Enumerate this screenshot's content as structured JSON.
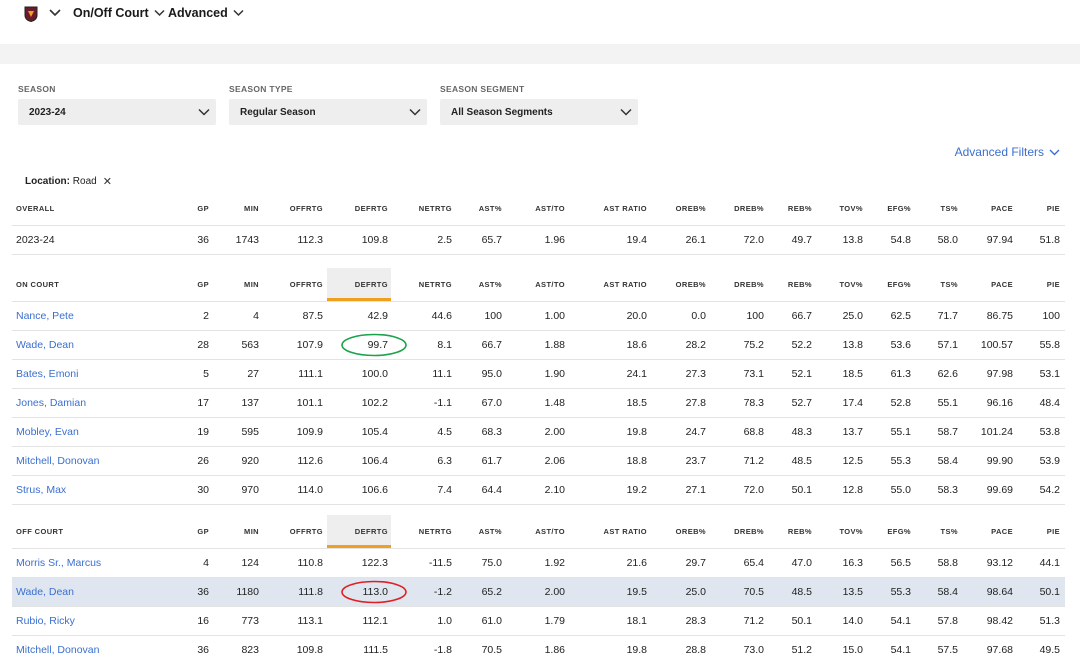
{
  "nav": {
    "items": [
      {
        "label": "On/Off Court"
      },
      {
        "label": "Advanced"
      }
    ]
  },
  "filters": [
    {
      "label": "SEASON",
      "value": "2023-24"
    },
    {
      "label": "SEASON TYPE",
      "value": "Regular Season"
    },
    {
      "label": "SEASON SEGMENT",
      "value": "All Season Segments"
    }
  ],
  "advanced_filters_label": "Advanced Filters",
  "location_tag": {
    "key": "Location:",
    "value": "Road"
  },
  "columns": [
    "GP",
    "MIN",
    "OFFRTG",
    "DEFRTG",
    "NETRTG",
    "AST%",
    "AST/TO",
    "AST RATIO",
    "OREB%",
    "DREB%",
    "REB%",
    "TOV%",
    "EFG%",
    "TS%",
    "PACE",
    "PIE"
  ],
  "overall": {
    "title": "OVERALL",
    "rows": [
      {
        "name": "2023-24",
        "values": [
          "36",
          "1743",
          "112.3",
          "109.8",
          "2.5",
          "65.7",
          "1.96",
          "19.4",
          "26.1",
          "72.0",
          "49.7",
          "13.8",
          "54.8",
          "58.0",
          "97.94",
          "51.8"
        ]
      }
    ]
  },
  "on_court": {
    "title": "ON COURT",
    "rows": [
      {
        "name": "Nance, Pete",
        "values": [
          "2",
          "4",
          "87.5",
          "42.9",
          "44.6",
          "100",
          "1.00",
          "20.0",
          "0.0",
          "100",
          "66.7",
          "25.0",
          "62.5",
          "71.7",
          "86.75",
          "100"
        ]
      },
      {
        "name": "Wade, Dean",
        "values": [
          "28",
          "563",
          "107.9",
          "99.7",
          "8.1",
          "66.7",
          "1.88",
          "18.6",
          "28.2",
          "75.2",
          "52.2",
          "13.8",
          "53.6",
          "57.1",
          "100.57",
          "55.8"
        ]
      },
      {
        "name": "Bates, Emoni",
        "values": [
          "5",
          "27",
          "111.1",
          "100.0",
          "11.1",
          "95.0",
          "1.90",
          "24.1",
          "27.3",
          "73.1",
          "52.1",
          "18.5",
          "61.3",
          "62.6",
          "97.98",
          "53.1"
        ]
      },
      {
        "name": "Jones, Damian",
        "values": [
          "17",
          "137",
          "101.1",
          "102.2",
          "-1.1",
          "67.0",
          "1.48",
          "18.5",
          "27.8",
          "78.3",
          "52.7",
          "17.4",
          "52.8",
          "55.1",
          "96.16",
          "48.4"
        ]
      },
      {
        "name": "Mobley, Evan",
        "values": [
          "19",
          "595",
          "109.9",
          "105.4",
          "4.5",
          "68.3",
          "2.00",
          "19.8",
          "24.7",
          "68.8",
          "48.3",
          "13.7",
          "55.1",
          "58.7",
          "101.24",
          "53.8"
        ]
      },
      {
        "name": "Mitchell, Donovan",
        "values": [
          "26",
          "920",
          "112.6",
          "106.4",
          "6.3",
          "61.7",
          "2.06",
          "18.8",
          "23.7",
          "71.2",
          "48.5",
          "12.5",
          "55.3",
          "58.4",
          "99.90",
          "53.9"
        ]
      },
      {
        "name": "Strus, Max",
        "values": [
          "30",
          "970",
          "114.0",
          "106.6",
          "7.4",
          "64.4",
          "2.10",
          "19.2",
          "27.1",
          "72.0",
          "50.1",
          "12.8",
          "55.0",
          "58.3",
          "99.69",
          "54.2"
        ]
      }
    ]
  },
  "off_court": {
    "title": "OFF COURT",
    "rows": [
      {
        "name": "Morris Sr., Marcus",
        "values": [
          "4",
          "124",
          "110.8",
          "122.3",
          "-11.5",
          "75.0",
          "1.92",
          "21.6",
          "29.7",
          "65.4",
          "47.0",
          "16.3",
          "56.5",
          "58.8",
          "93.12",
          "44.1"
        ]
      },
      {
        "name": "Wade, Dean",
        "values": [
          "36",
          "1180",
          "111.8",
          "113.0",
          "-1.2",
          "65.2",
          "2.00",
          "19.5",
          "25.0",
          "70.5",
          "48.5",
          "13.5",
          "55.3",
          "58.4",
          "98.64",
          "50.1"
        ]
      },
      {
        "name": "Rubio, Ricky",
        "values": [
          "16",
          "773",
          "113.1",
          "112.1",
          "1.0",
          "61.0",
          "1.79",
          "18.1",
          "28.3",
          "71.2",
          "50.1",
          "14.0",
          "54.1",
          "57.8",
          "98.42",
          "51.3"
        ]
      },
      {
        "name": "Mitchell, Donovan",
        "values": [
          "36",
          "823",
          "109.8",
          "111.5",
          "-1.8",
          "70.5",
          "1.86",
          "19.8",
          "28.8",
          "73.0",
          "51.2",
          "15.0",
          "54.1",
          "57.5",
          "97.68",
          "49.5"
        ]
      }
    ]
  },
  "colors": {
    "link": "#3a6fd0",
    "sort_accent": "#f0a020",
    "highlight_row": "#dfe6f0",
    "circle_green": "#1aa34a",
    "circle_red": "#e02020"
  }
}
